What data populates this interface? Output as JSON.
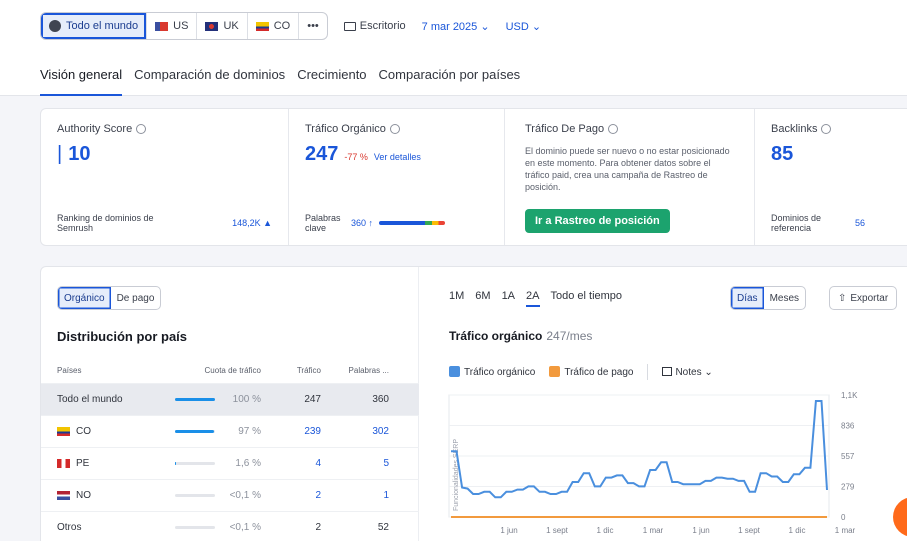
{
  "filters": {
    "regions": [
      {
        "label": "Todo el mundo",
        "icon": "globe-icon",
        "active": true
      },
      {
        "label": "US",
        "icon": "us-flag-icon"
      },
      {
        "label": "UK",
        "icon": "uk-flag-icon"
      },
      {
        "label": "CO",
        "icon": "co-flag-icon"
      },
      {
        "label": "•••",
        "icon": "more-icon"
      }
    ],
    "device": "Escritorio",
    "date": "7 mar 2025 ⌄",
    "currency": "USD ⌄"
  },
  "tabs": [
    "Visión general",
    "Comparación de dominios",
    "Crecimiento",
    "Comparación por países"
  ],
  "metrics": {
    "authority": {
      "title": "Authority Score",
      "value": "10",
      "foot_label": "Ranking de dominios de Semrush",
      "foot_value": "148,2K ▲"
    },
    "organic": {
      "title": "Tráfico Orgánico",
      "value": "247",
      "change": "-77 %",
      "link": "Ver detalles",
      "foot_label": "Palabras clave",
      "foot_value": "360 ↑"
    },
    "paid": {
      "title": "Tráfico De Pago",
      "desc": "El dominio puede ser nuevo o no estar posicionado en este momento. Para obtener datos sobre el tráfico paid, crea una campaña de Rastreo de posición.",
      "cta": "Ir a Rastreo de posición"
    },
    "backlinks": {
      "title": "Backlinks",
      "value": "85",
      "foot_label": "Dominios de referencia",
      "foot_value": "56"
    }
  },
  "left_panel": {
    "toggle": [
      "Orgánico",
      "De pago"
    ],
    "title": "Distribución por país",
    "headers": {
      "country": "Países",
      "share": "Cuota de tráfico",
      "traffic": "Tráfico",
      "keywords": "Palabras ..."
    },
    "rows": [
      {
        "country": "Todo el mundo",
        "flag": "",
        "share": "100 %",
        "share_value": 1.0,
        "traffic": "247",
        "keywords": "360"
      },
      {
        "country": "CO",
        "flag": "co",
        "share": "97 %",
        "share_value": 0.97,
        "traffic": "239",
        "keywords": "302"
      },
      {
        "country": "PE",
        "flag": "pe",
        "share": "1,6 %",
        "share_value": 0.016,
        "traffic": "4",
        "keywords": "5"
      },
      {
        "country": "NO",
        "flag": "no",
        "share": "<0,1 %",
        "share_value": 0.001,
        "traffic": "2",
        "keywords": "1"
      },
      {
        "country": "Otros",
        "flag": "",
        "share": "<0,1 %",
        "share_value": 0.001,
        "traffic": "2",
        "keywords": "52"
      }
    ]
  },
  "right_panel": {
    "periods": [
      "1M",
      "6M",
      "1A",
      "2A",
      "Todo el tiempo"
    ],
    "granularity": [
      "Días",
      "Meses"
    ],
    "export": "Exportar",
    "chart_title": "Tráfico orgánico",
    "chart_subtitle": "247/mes",
    "legend": {
      "organic": "Tráfico orgánico",
      "paid": "Tráfico de pago",
      "notes": "Notes ⌄"
    },
    "colors": {
      "organic": "#4a8fde",
      "paid": "#f29a3d"
    }
  },
  "chart_data": {
    "type": "line",
    "ylabel": "Funcionalidades SERP",
    "y_ticks": [
      "1,1K",
      "836",
      "557",
      "279",
      "0"
    ],
    "x_ticks": [
      "1 jun",
      "1 sept",
      "1 dic",
      "1 mar",
      "1 jun",
      "1 sept",
      "1 dic",
      "1 mar"
    ],
    "ylim": [
      0,
      1115
    ],
    "series": [
      {
        "name": "Tráfico orgánico",
        "values": [
          600,
          600,
          270,
          260,
          210,
          210,
          230,
          230,
          180,
          180,
          230,
          230,
          250,
          250,
          280,
          280,
          230,
          230,
          210,
          210,
          230,
          230,
          320,
          320,
          400,
          400,
          280,
          280,
          360,
          360,
          380,
          380,
          310,
          310,
          280,
          280,
          430,
          430,
          500,
          500,
          320,
          320,
          300,
          300,
          300,
          300,
          330,
          330,
          360,
          360,
          350,
          350,
          330,
          330,
          230,
          230,
          400,
          400,
          370,
          370,
          320,
          320,
          390,
          390,
          450,
          450,
          1060,
          1060,
          247
        ]
      },
      {
        "name": "Tráfico de pago",
        "values": [
          0,
          0,
          0,
          0,
          0,
          0,
          0,
          0,
          0,
          0,
          0,
          0,
          0,
          0,
          0,
          0,
          0,
          0,
          0,
          0,
          0,
          0,
          0,
          0,
          0,
          0,
          0,
          0,
          0,
          0,
          0,
          0,
          0,
          0,
          0,
          0,
          0,
          0,
          0,
          0,
          0,
          0,
          0,
          0,
          0,
          0,
          0,
          0,
          0,
          0,
          0,
          0,
          0,
          0,
          0,
          0,
          0,
          0,
          0,
          0,
          0,
          0,
          0,
          0,
          0,
          0,
          0,
          0,
          0
        ]
      }
    ]
  }
}
